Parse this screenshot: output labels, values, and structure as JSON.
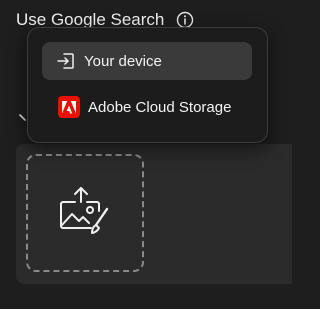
{
  "header": {
    "title": "Use Google Search"
  },
  "menu": {
    "items": [
      {
        "label": "Your device",
        "icon": "sign-in-icon",
        "selected": true
      },
      {
        "label": "Adobe Cloud Storage",
        "icon": "adobe-logo-icon",
        "selected": false
      }
    ]
  },
  "upload": {
    "icon": "upload-image-edit-icon"
  },
  "colors": {
    "background": "#1e1e1e",
    "panel": "#2b2b2b",
    "popover": "#1c1c1c",
    "selected_item": "#3a3a3a",
    "adobe_red": "#eb1000"
  }
}
